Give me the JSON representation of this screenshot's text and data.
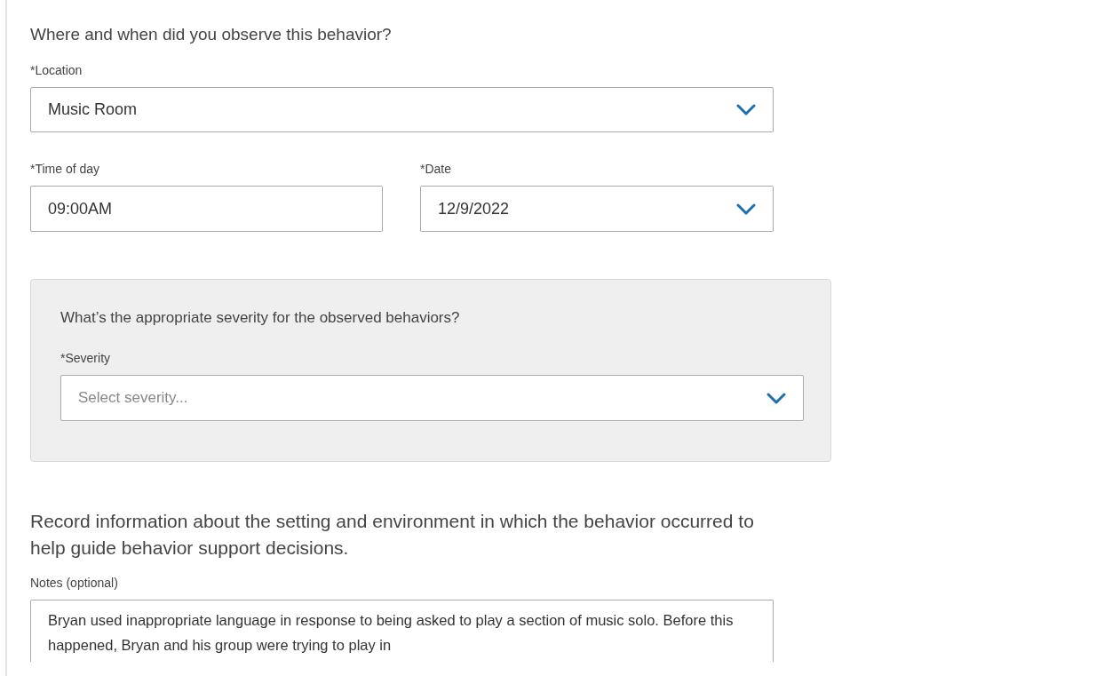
{
  "section_heading": "Where and when did you observe this behavior?",
  "location": {
    "label": "*Location",
    "value": "Music Room"
  },
  "time_of_day": {
    "label": "*Time of day",
    "value": "09:00AM"
  },
  "date": {
    "label": "*Date",
    "value": "12/9/2022"
  },
  "severity_panel": {
    "question": "What’s the appropriate severity for the observed behaviors?",
    "label": "*Severity",
    "placeholder": "Select severity..."
  },
  "setting_heading": "Record information about the setting and environment in which the behavior occurred to help guide behavior support decisions.",
  "notes": {
    "label": "Notes (optional)",
    "value": "Bryan used inappropriate language in response to being asked to play a section of music solo. Before this happened, Bryan and his group were trying to play in"
  }
}
